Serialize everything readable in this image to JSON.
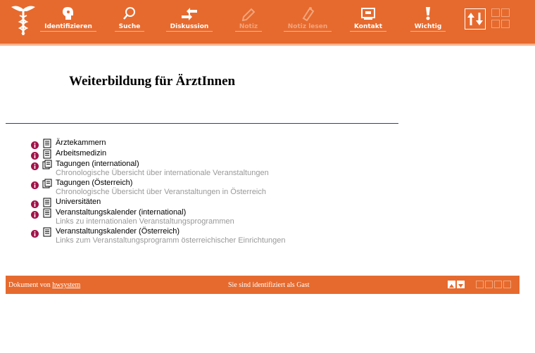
{
  "toolbar": {
    "items": [
      {
        "label": "Identifizieren",
        "icon": "identify-head-icon",
        "enabled": true
      },
      {
        "label": "Suche",
        "icon": "search-icon",
        "enabled": true
      },
      {
        "label": "Diskussion",
        "icon": "discussion-arrows-icon",
        "enabled": true
      },
      {
        "label": "Notiz",
        "icon": "note-pencil-icon",
        "enabled": false
      },
      {
        "label": "Notiz lesen",
        "icon": "read-note-icon",
        "enabled": false
      },
      {
        "label": "Kontakt",
        "icon": "contact-screen-icon",
        "enabled": true
      },
      {
        "label": "Wichtig",
        "icon": "important-exclamation-icon",
        "enabled": true
      }
    ],
    "brand_color": "#e66a2e"
  },
  "main": {
    "title": "Weiterbildung für ÄrztInnen",
    "items": [
      {
        "label": "Ärztekammern",
        "description": "",
        "icon": "document-icon"
      },
      {
        "label": "Arbeitsmedizin",
        "description": "",
        "icon": "document-icon"
      },
      {
        "label": "Tagungen (international)",
        "description": "Chronologische Übersicht über internationale Veranstaltungen",
        "icon": "documents-stack-icon"
      },
      {
        "label": "Tagungen (Österreich)",
        "description": "Chronologische Übersicht über Veranstaltungen in Österreich",
        "icon": "documents-stack-icon"
      },
      {
        "label": "Universitäten",
        "description": "",
        "icon": "document-icon"
      },
      {
        "label": "Veranstaltungskalender (international)",
        "description": "Links zu internationalen Veranstaltungsprogrammen",
        "icon": "document-icon"
      },
      {
        "label": "Veranstaltungskalender (Österreich)",
        "description": "Links zum Veranstaltungsprogramm österreichischer Einrichtungen",
        "icon": "document-icon"
      }
    ]
  },
  "footer": {
    "document_prefix": "Dokument von",
    "document_link": "hwsystem",
    "status": "Sie sind identifiziert als Gast"
  }
}
